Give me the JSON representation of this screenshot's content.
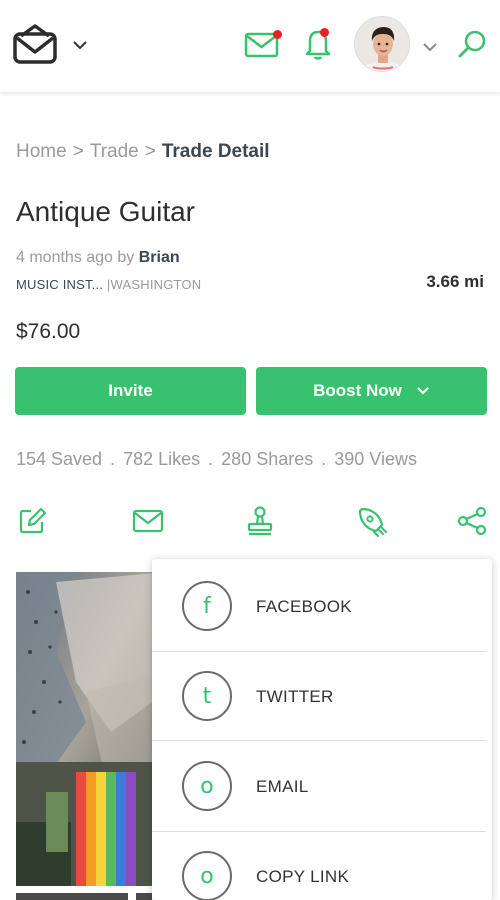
{
  "header": {
    "logo_icon": "shopping-bag-icon",
    "messages_icon": "envelope-icon",
    "notifications_icon": "bell-icon",
    "search_icon": "search-icon",
    "accent_color": "#38c16e",
    "badge_color": "#e52222"
  },
  "breadcrumb": {
    "home": "Home",
    "trade": "Trade",
    "separator": ">",
    "current": "Trade Detail"
  },
  "listing": {
    "title": "Antique Guitar",
    "posted_prefix": "4 months ago by",
    "author": "Brian",
    "category": "MUSIC INST...",
    "location_sep": "|",
    "location": "WASHINGTON",
    "distance": "3.66 mi",
    "price": "$76.00"
  },
  "buttons": {
    "invite": "Invite",
    "boost": "Boost Now"
  },
  "stats": {
    "saved": "154 Saved",
    "likes": "782 Likes",
    "shares": "280 Shares",
    "views": "390 Views",
    "separator": "."
  },
  "actions": [
    "edit-icon",
    "envelope-icon",
    "stamp-icon",
    "rocket-icon",
    "share-icon"
  ],
  "share_menu": {
    "items": [
      {
        "label": "FACEBOOK",
        "glyph": "f"
      },
      {
        "label": "TWITTER",
        "glyph": "t"
      },
      {
        "label": "EMAIL",
        "glyph": "o"
      },
      {
        "label": "COPY LINK",
        "glyph": "o"
      }
    ]
  }
}
